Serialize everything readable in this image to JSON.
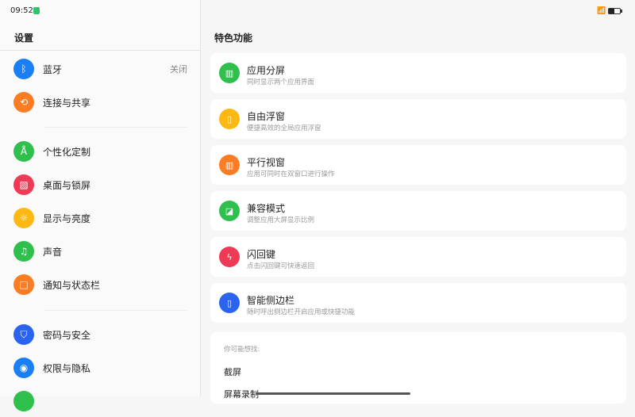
{
  "status": {
    "time": "09:52",
    "battery_percent": 50
  },
  "left": {
    "title": "设置",
    "items": [
      {
        "label": "蓝牙",
        "value": "关闭",
        "icon": "bluetooth-icon",
        "color": "#1a7ff5"
      },
      {
        "label": "连接与共享",
        "icon": "share-icon",
        "color": "#fb7c23"
      },
      {
        "label": "个性化定制",
        "icon": "compass-icon",
        "color": "#2fbf4d"
      },
      {
        "label": "桌面与锁屏",
        "icon": "image-icon",
        "color": "#ef3a55"
      },
      {
        "label": "显示与亮度",
        "icon": "sun-icon",
        "color": "#fdb813"
      },
      {
        "label": "声音",
        "icon": "bell-icon",
        "color": "#2fbf4d"
      },
      {
        "label": "通知与状态栏",
        "icon": "notification-icon",
        "color": "#fb7c23"
      },
      {
        "label": "密码与安全",
        "icon": "shield-icon",
        "color": "#2a63f0"
      },
      {
        "label": "权限与隐私",
        "icon": "privacy-icon",
        "color": "#1a7ff5"
      }
    ]
  },
  "right": {
    "title": "特色功能",
    "cards": [
      {
        "title": "应用分屏",
        "sub": "同时显示两个应用界面",
        "color": "#2fbf4d",
        "icon": "split-screen-icon"
      },
      {
        "title": "自由浮窗",
        "sub": "便捷高效的全局应用浮窗",
        "color": "#fdb813",
        "icon": "floating-window-icon"
      },
      {
        "title": "平行视窗",
        "sub": "应用可同时在双窗口进行操作",
        "color": "#fb7c23",
        "icon": "parallel-window-icon"
      },
      {
        "title": "兼容模式",
        "sub": "调整应用大屏显示比例",
        "color": "#2fbf4d",
        "icon": "compat-mode-icon"
      },
      {
        "title": "闪回键",
        "sub": "点击闪回键可快速返回",
        "color": "#ef3a55",
        "icon": "flash-icon"
      },
      {
        "title": "智能侧边栏",
        "sub": "随时呼出侧边栏开启应用或快捷功能",
        "color": "#2a63f0",
        "icon": "sidebar-icon"
      }
    ],
    "suggest": {
      "heading": "你可能想找:",
      "items": [
        "截屏",
        "屏幕录制"
      ]
    }
  }
}
